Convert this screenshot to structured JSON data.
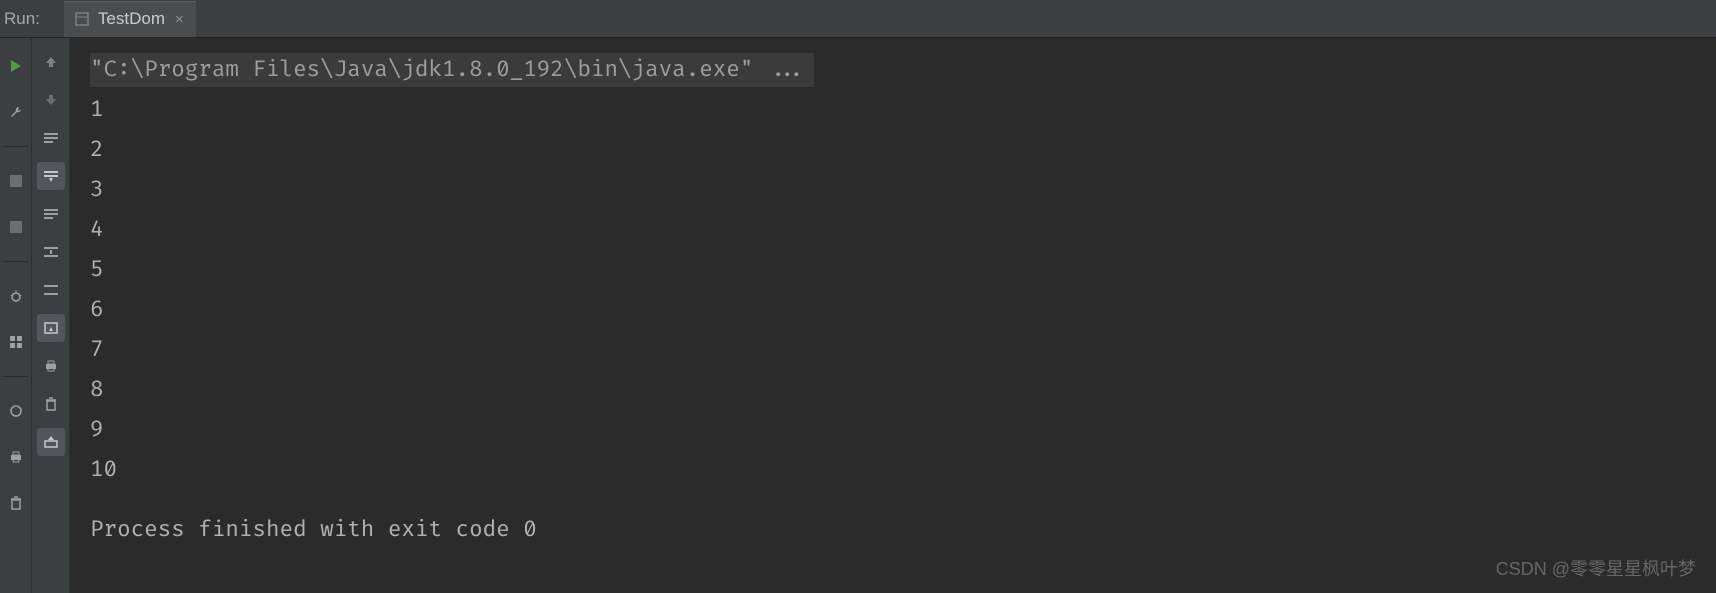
{
  "header": {
    "run_label": "Run:",
    "tab": {
      "title": "TestDom",
      "close_glyph": "×"
    }
  },
  "console": {
    "command": "\"C:\\Program Files\\Java\\jdk1.8.0_192\\bin\\java.exe\" ...",
    "lines": [
      "1",
      "2",
      "3",
      "4",
      "5",
      "6",
      "7",
      "8",
      "9",
      "10"
    ],
    "exit_line": "Process finished with exit code 0"
  },
  "watermark": "CSDN @零零星星枫叶梦",
  "left_gutter_icons": [
    "play-icon",
    "wrench-icon",
    "stop-icon",
    "stop-icon",
    "bug-icon",
    "layout-icon",
    "bug-restart-icon",
    "print-icon",
    "trash-icon"
  ],
  "tool_icons": [
    "arrow-up-icon",
    "arrow-down-icon",
    "wrap-lines-icon",
    "filter-icon",
    "wrap-lines-2-icon",
    "rerun-icon",
    "wrap-icon",
    "capture-icon",
    "print-icon",
    "trash-icon",
    "export-icon"
  ]
}
